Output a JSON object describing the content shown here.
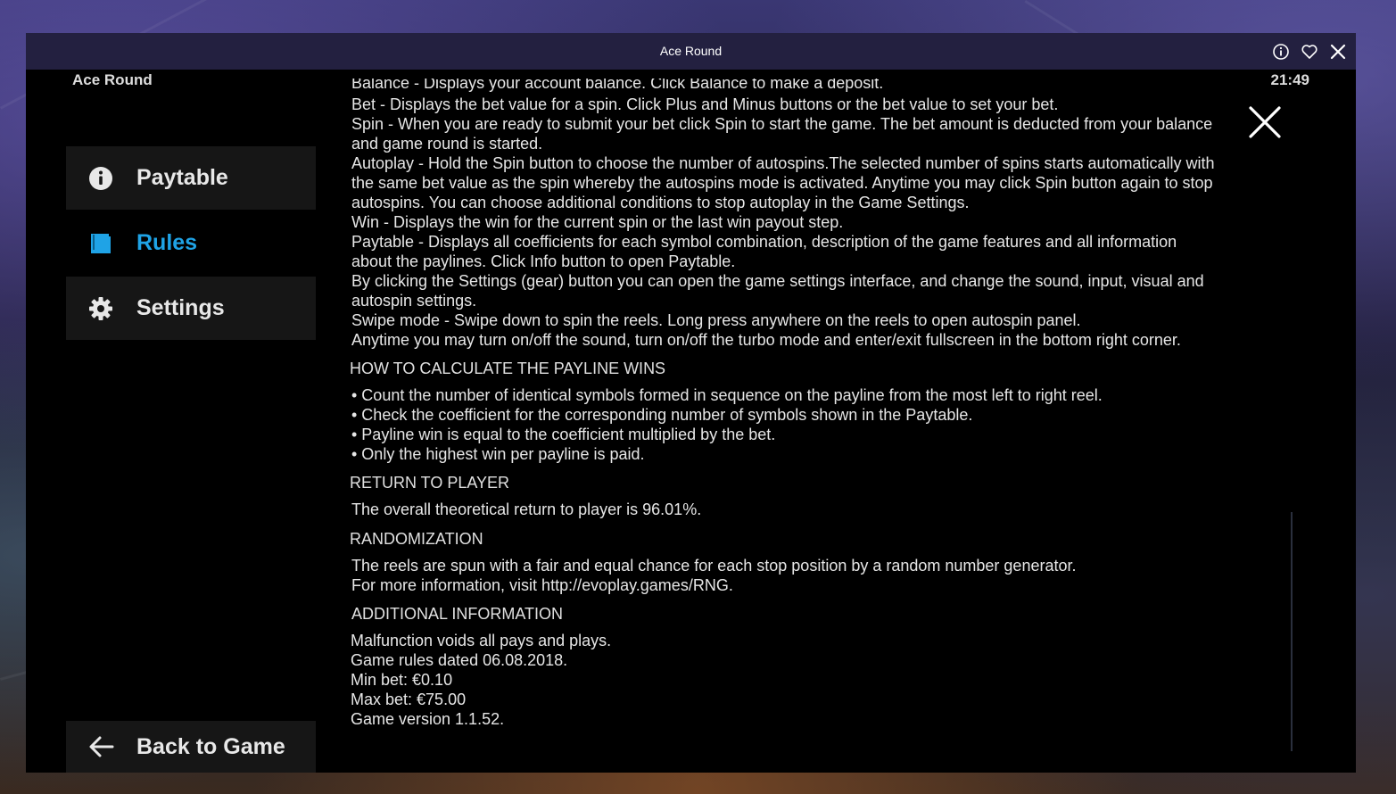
{
  "window": {
    "title": "Ace Round",
    "icons": [
      "info-icon",
      "heart-icon",
      "close-icon"
    ]
  },
  "header": {
    "game_label": "Ace Round",
    "clock": "21:49"
  },
  "sidebar": {
    "items": [
      {
        "label": "Paytable",
        "icon": "info-circle-icon",
        "active": false
      },
      {
        "label": "Rules",
        "icon": "book-icon",
        "active": true
      },
      {
        "label": "Settings",
        "icon": "gear-icon",
        "active": false
      }
    ],
    "back_label": "Back to Game"
  },
  "rules": {
    "cut_line": "Balance - Displays your account balance. Click Balance to make a deposit.",
    "controls": [
      "Bet - Displays the bet value for a spin. Click Plus and Minus buttons or the bet value to set your bet.",
      "Spin - When you are ready to submit your bet click Spin to start the game. The bet amount is deducted from your balance",
      "and game round is started.",
      "Autoplay - Hold the Spin button to choose the number of autospins.The selected number of spins starts automatically with",
      "the same bet value as the spin whereby the autospins mode is activated. Anytime you may click Spin button again to stop",
      "autospins. You can choose additional conditions to stop autoplay in the Game Settings.",
      "Win - Displays the win for the current spin or the last win payout step.",
      "Paytable - Displays all coefficients for each symbol combination, description of the game features and all information",
      "about the paylines. Click Info button to open Paytable.",
      "By clicking the Settings (gear) button you can open the game settings interface, and change the sound, input, visual and",
      "autospin settings.",
      "Swipe mode - Swipe down to spin the reels. Long press anywhere on the reels to open autospin panel.",
      "Anytime you may turn on/off the sound, turn on/off the turbo mode and enter/exit fullscreen in the bottom right corner."
    ],
    "payline_heading": "HOW TO CALCULATE THE PAYLINE WINS",
    "payline_items": [
      "• Count the number of identical symbols formed in sequence on the payline from the most left to right reel.",
      "• Check the coefficient for the corresponding number of symbols shown in the Paytable.",
      "• Payline win is equal to the coefficient multiplied by the bet.",
      "• Only the highest win per payline is paid."
    ],
    "rtp_heading": "RETURN TO PLAYER",
    "rtp_text": "The overall theoretical return to player is 96.01%.",
    "random_heading": "RANDOMIZATION",
    "random_lines": [
      "The reels are spun with a fair and equal chance for each stop position by a random number generator.",
      "For more information, visit http://evoplay.games/RNG."
    ],
    "additional_heading": "ADDITIONAL INFORMATION",
    "additional_lines": [
      "Malfunction voids all pays and plays.",
      "Game rules dated 06.08.2018.",
      "Min bet: €0.10",
      "Max bet: €75.00",
      "Game version 1.1.52."
    ]
  },
  "colors": {
    "accent": "#1fa3e6",
    "titlebar": "#232040",
    "sidebar_item": "#161616",
    "panel": "#000000"
  }
}
